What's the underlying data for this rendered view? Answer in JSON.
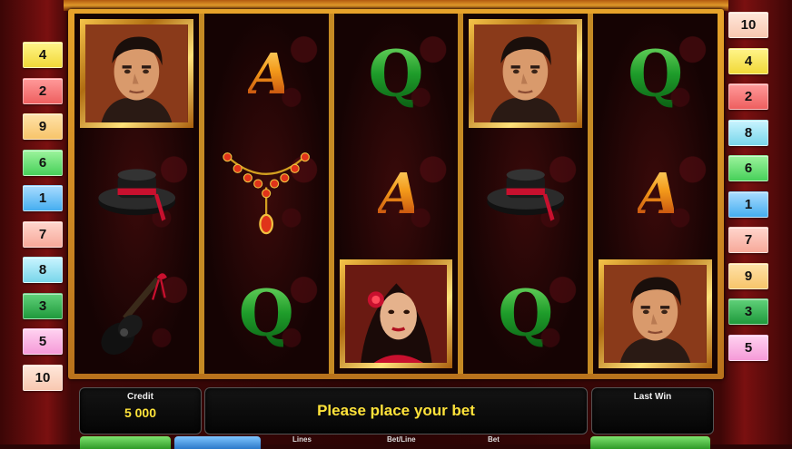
{
  "paylines_left": [
    {
      "label": "4",
      "color": "yellow"
    },
    {
      "label": "2",
      "color": "red"
    },
    {
      "label": "9",
      "color": "orange"
    },
    {
      "label": "6",
      "color": "green"
    },
    {
      "label": "1",
      "color": "blue"
    },
    {
      "label": "7",
      "color": "salmon"
    },
    {
      "label": "8",
      "color": "cyan"
    },
    {
      "label": "3",
      "color": "dgreen"
    },
    {
      "label": "5",
      "color": "pink"
    },
    {
      "label": "10",
      "color": "peach"
    }
  ],
  "paylines_right": [
    {
      "label": "10",
      "color": "peach"
    },
    {
      "label": "4",
      "color": "yellow"
    },
    {
      "label": "2",
      "color": "red"
    },
    {
      "label": "8",
      "color": "cyan"
    },
    {
      "label": "6",
      "color": "green"
    },
    {
      "label": "1",
      "color": "blue"
    },
    {
      "label": "7",
      "color": "salmon"
    },
    {
      "label": "9",
      "color": "orange"
    },
    {
      "label": "3",
      "color": "dgreen"
    },
    {
      "label": "5",
      "color": "pink"
    }
  ],
  "reels": [
    [
      "man",
      "hat",
      "guitar"
    ],
    [
      "A",
      "necklace",
      "Q"
    ],
    [
      "Q",
      "A",
      "woman"
    ],
    [
      "man",
      "hat",
      "Q"
    ],
    [
      "Q",
      "A",
      "man"
    ]
  ],
  "symbol_text": {
    "A": "A",
    "Q": "Q"
  },
  "credit": {
    "label": "Credit",
    "value": "5 000"
  },
  "message": "Please place your bet",
  "last_win": {
    "label": "Last Win",
    "value": ""
  },
  "bottom_labels": {
    "lines": "Lines",
    "bet_line": "Bet/Line",
    "bet": "Bet"
  }
}
